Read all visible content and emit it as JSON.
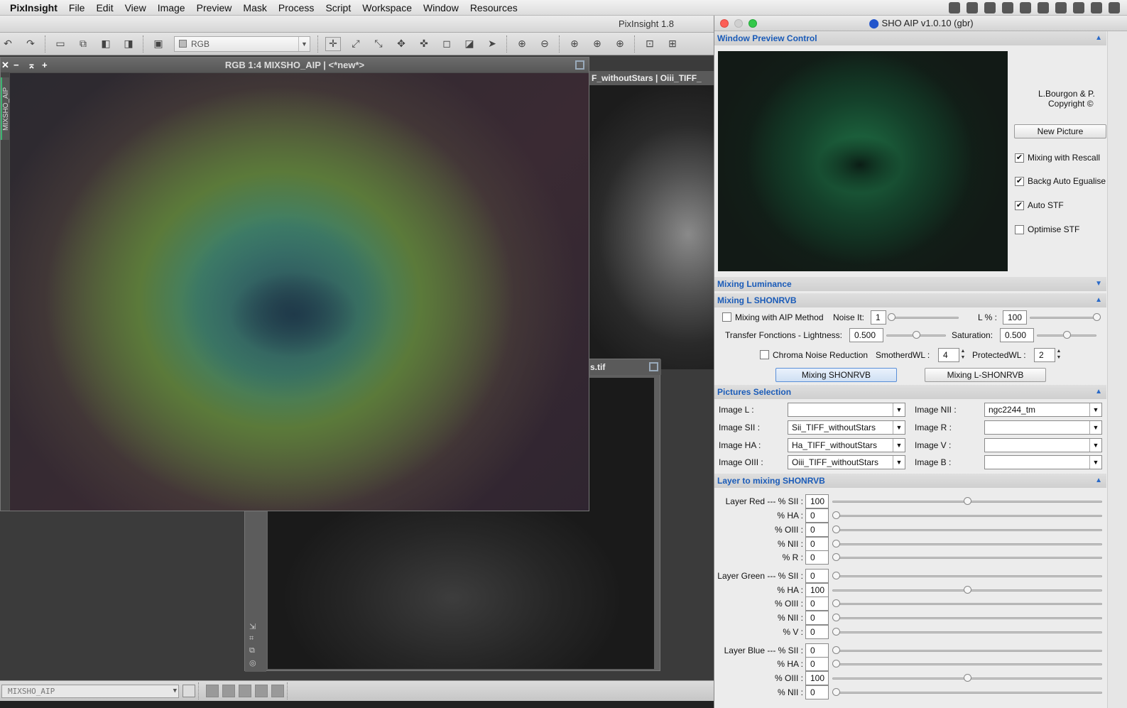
{
  "menubar": {
    "app": "PixInsight",
    "items": [
      "File",
      "Edit",
      "View",
      "Image",
      "Preview",
      "Mask",
      "Process",
      "Script",
      "Workspace",
      "Window",
      "Resources"
    ],
    "tray_icons": [
      "dropbox-icon",
      "cloud-icon",
      "wifi-icon",
      "battery-icon",
      "cloud2-icon",
      "puzzle-icon",
      "wd-icon",
      "location-icon",
      "clock-icon",
      "check-icon"
    ]
  },
  "pi_window": {
    "title": "PixInsight 1.8"
  },
  "toolbar": {
    "view_select": "RGB"
  },
  "main_image": {
    "title": "RGB 1:4 MIXSHO_AIP | <*new*>",
    "side_tab": "MIXSHO_AIP"
  },
  "bg_window_1": {
    "title": "F_withoutStars | Oiii_TIFF_"
  },
  "bg_window_2": {
    "title": "s.tif"
  },
  "statusbar": {
    "view": "MIXSHO_AIP"
  },
  "dialog": {
    "title": "SHO AIP v1.0.10 (gbr)",
    "window_preview": {
      "header": "Window Preview Control",
      "credit_1": "L.Bourgon & P.",
      "credit_2": "Copyright ©",
      "new_picture": "New Picture",
      "options": [
        {
          "label": "Mixing with Rescall",
          "checked": true
        },
        {
          "label": "Backg Auto Egualise",
          "checked": true
        },
        {
          "label": "Auto STF",
          "checked": true
        },
        {
          "label": "Optimise STF",
          "checked": false
        }
      ]
    },
    "mixing_luminance": {
      "header": "Mixing Luminance"
    },
    "mixing_l": {
      "header": "Mixing L SHONRVB",
      "aip_method": "Mixing with AIP Method",
      "aip_checked": false,
      "noise_label": "Noise It:",
      "noise_value": "1",
      "noise_level": 0,
      "lpct_label": "L % :",
      "lpct_value": "100",
      "lpct_level": 1.0,
      "tf_label": "Transfer Fonctions - Lightness:",
      "tf_value": "0.500",
      "tf_level": 0.5,
      "sat_label": "Saturation:",
      "sat_value": "0.500",
      "sat_level": 0.5,
      "chroma_label": "Chroma Noise Reduction",
      "chroma_checked": false,
      "smoothed_label": "SmotherdWL :",
      "smoothed_value": "4",
      "protected_label": "ProtectedWL :",
      "protected_value": "2",
      "btn_mix": "Mixing SHONRVB",
      "btn_mix_l": "Mixing L-SHONRVB"
    },
    "pictures": {
      "header": "Pictures Selection",
      "left": [
        {
          "label": "Image L :",
          "value": ""
        },
        {
          "label": "Image  SII :",
          "value": "Sii_TIFF_withoutStars"
        },
        {
          "label": "Image  HA :",
          "value": "Ha_TIFF_withoutStars"
        },
        {
          "label": "Image  OIII :",
          "value": "Oiii_TIFF_withoutStars"
        }
      ],
      "right": [
        {
          "label": "Image  NII :",
          "value": "ngc2244_tm"
        },
        {
          "label": "Image  R :",
          "value": ""
        },
        {
          "label": "Image  V :",
          "value": ""
        },
        {
          "label": "Image  B :",
          "value": ""
        }
      ]
    },
    "layers": {
      "header": "Layer to mixing SHONRVB",
      "rows": [
        {
          "label": "Layer Red --- % SII :",
          "value": "100",
          "level": 0.5
        },
        {
          "label": "% HA :",
          "value": "0",
          "level": 0
        },
        {
          "label": "% OIII :",
          "value": "0",
          "level": 0
        },
        {
          "label": "% NII :",
          "value": "0",
          "level": 0
        },
        {
          "label": "% R :",
          "value": "0",
          "level": 0
        },
        {
          "label": "Layer Green --- % SII :",
          "value": "0",
          "level": 0
        },
        {
          "label": "% HA :",
          "value": "100",
          "level": 0.5
        },
        {
          "label": "% OIII :",
          "value": "0",
          "level": 0
        },
        {
          "label": "% NII :",
          "value": "0",
          "level": 0
        },
        {
          "label": "% V :",
          "value": "0",
          "level": 0
        },
        {
          "label": "Layer Blue --- % SII :",
          "value": "0",
          "level": 0
        },
        {
          "label": "% HA :",
          "value": "0",
          "level": 0
        },
        {
          "label": "% OIII :",
          "value": "100",
          "level": 0.5
        },
        {
          "label": "% NII :",
          "value": "0",
          "level": 0
        }
      ]
    }
  },
  "colors": {
    "section_text": "#1a5bb8",
    "accent_green": "#3cb371"
  }
}
